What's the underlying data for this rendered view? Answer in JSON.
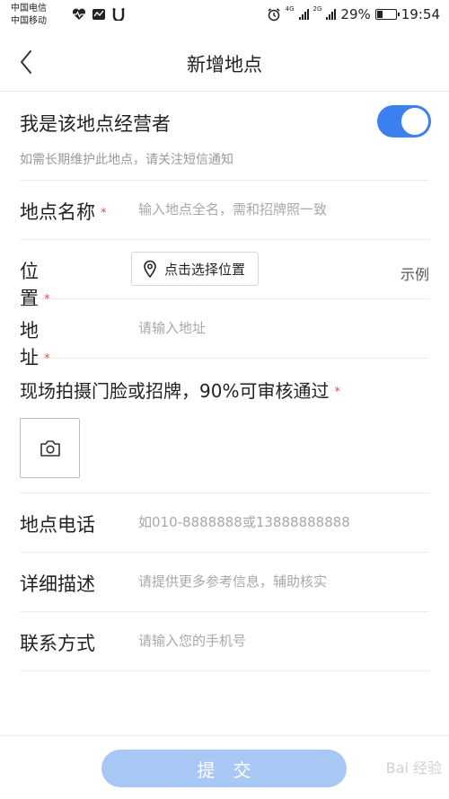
{
  "status_bar": {
    "carrier_1": "中国电信",
    "carrier_2": "中国移动",
    "network_4g": "4G",
    "network_2g": "2G",
    "battery": "29%",
    "battery_level": 0.29,
    "time": "19:54",
    "icons": [
      "heart-rate-icon",
      "activity-icon",
      "notification-icon",
      "alarm-icon",
      "signal-icon",
      "battery-icon"
    ]
  },
  "header": {
    "back_icon": "chevron-left-icon",
    "title": "新增地点"
  },
  "owner": {
    "label": "我是该地点经营者",
    "hint": "如需长期维护此地点，请关注短信通知",
    "toggle_on": true,
    "accent_color": "#3b7ff0"
  },
  "form": {
    "required_mark": "*",
    "name": {
      "label": "地点名称",
      "placeholder": "输入地点全名，需和招牌照一致"
    },
    "position": {
      "label": "位置",
      "button": "点击选择位置",
      "example": "示例"
    },
    "address": {
      "label": "地址",
      "placeholder": "请输入地址"
    },
    "photo": {
      "label": "现场拍摄门脸或招牌，90%可审核通过",
      "icon": "camera-icon"
    },
    "phone": {
      "label": "地点电话",
      "placeholder": "如010-8888888或13888888888"
    },
    "description": {
      "label": "详细描述",
      "placeholder": "请提供更多参考信息，辅助核实"
    },
    "contact": {
      "label": "联系方式",
      "placeholder": "请输入您的手机号"
    }
  },
  "footer": {
    "submit": "提交",
    "submit_color": "#a8c7f5",
    "watermark": "Bai 经验"
  }
}
